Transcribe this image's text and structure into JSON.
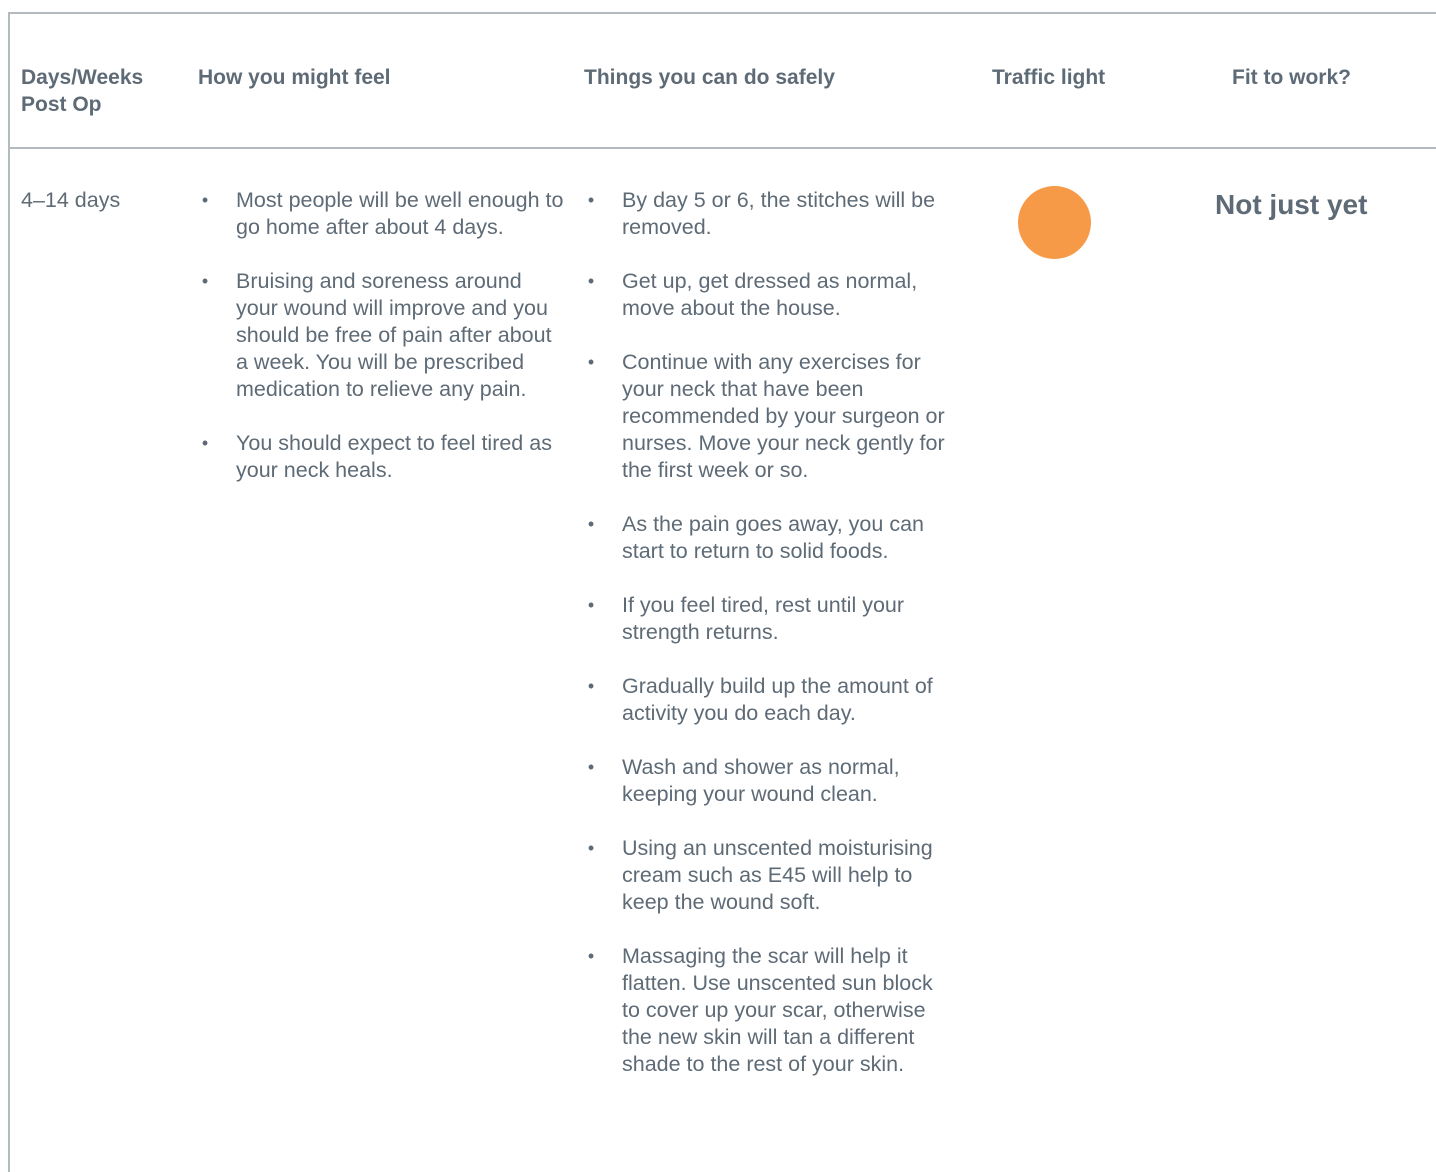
{
  "headers": {
    "days": "Days/Weeks Post Op",
    "feel": "How you might feel",
    "things": "Things you can do safely",
    "traffic": "Traffic light",
    "fit": "Fit to work?"
  },
  "row": {
    "days": "4–14 days",
    "feel": [
      "Most people will be well enough to go home after about 4 days.",
      "Bruising and soreness around your wound will improve and you should be free of pain after about a week. You will be prescribed medication to relieve any pain.",
      "You should expect to feel tired as your neck heals."
    ],
    "things": [
      "By day 5 or 6, the stitches will be removed.",
      "Get up, get dressed as normal, move about the house.",
      "Continue with any exercises for your neck that have been recommended by your surgeon or nurses. Move your neck gently for the first week or so.",
      "As the pain goes away, you can start to return to solid foods.",
      "If you feel tired, rest until your strength returns.",
      "Gradually build up the amount of activity you do each day.",
      "Wash and shower as normal, keeping your wound clean.",
      "Using an unscented moisturising cream such as E45 will help to keep the wound soft.",
      "Massaging the scar will help it flatten. Use unscented sun block to cover up your scar, otherwise the new skin will tan a different shade to the rest of your skin."
    ],
    "traffic_light_color": "#f79a48",
    "fit": "Not just yet"
  },
  "bullet_glyph": "•"
}
